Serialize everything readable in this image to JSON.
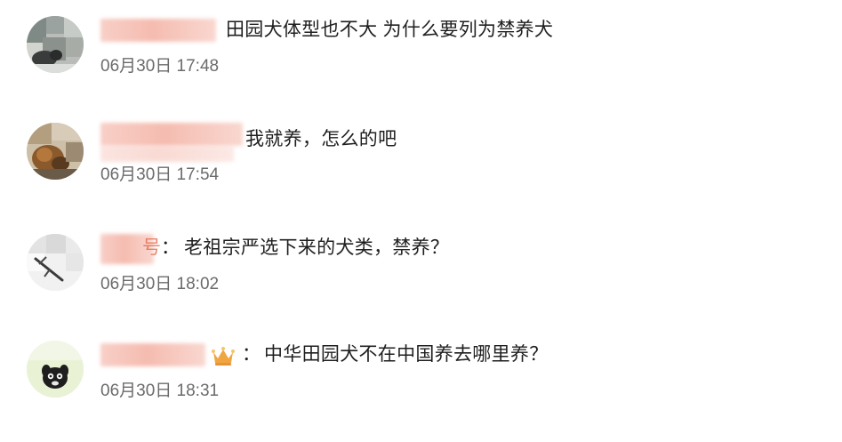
{
  "comments": [
    {
      "avatar": "gray-dog-avatar",
      "name": "",
      "text": "田园犬体型也不大 为什么要列为禁养犬",
      "timestamp": "06月30日 17:48"
    },
    {
      "avatar": "brown-dog-avatar",
      "name": "",
      "text": "我就养，怎么的吧",
      "timestamp": "06月30日 17:54"
    },
    {
      "avatar": "sketch-avatar",
      "name": "",
      "name_fragment": "号",
      "colon": "：",
      "text": "老祖宗严选下来的犬类，禁养？",
      "timestamp": "06月30日 18:02"
    },
    {
      "avatar": "cartoon-dog-avatar",
      "name": "",
      "badge": "crown-icon",
      "colon": "：",
      "text": "中华田园犬不在中国养去哪里养？",
      "timestamp": "06月30日 18:31"
    }
  ],
  "colors": {
    "text": "#1f1f1f",
    "timestamp": "#6b6b6b",
    "name_blur": "#f5bcb0",
    "crown": "#f0a640"
  }
}
